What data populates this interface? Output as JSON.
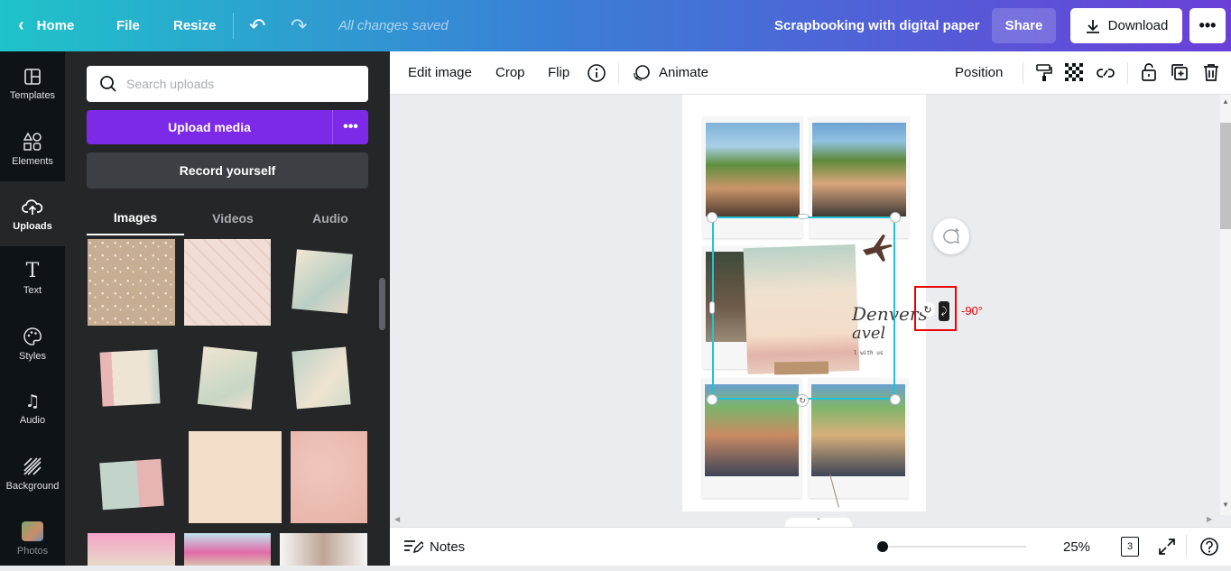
{
  "topbar": {
    "home": "Home",
    "file": "File",
    "resize": "Resize",
    "saved": "All changes saved",
    "title": "Scrapbooking with digital paper",
    "share": "Share",
    "download": "Download",
    "gradient": [
      "#1fc3c9",
      "#3a7fd6",
      "#6a3fd8"
    ]
  },
  "rail": {
    "items": [
      {
        "label": "Templates",
        "icon": "templates-icon"
      },
      {
        "label": "Elements",
        "icon": "elements-icon"
      },
      {
        "label": "Uploads",
        "icon": "upload-cloud-icon"
      },
      {
        "label": "Text",
        "icon": "text-icon"
      },
      {
        "label": "Styles",
        "icon": "palette-icon"
      },
      {
        "label": "Audio",
        "icon": "music-note-icon"
      },
      {
        "label": "Background",
        "icon": "background-icon"
      },
      {
        "label": "Photos",
        "icon": "photos-icon"
      }
    ],
    "active": "Uploads"
  },
  "panel": {
    "search_placeholder": "Search uploads",
    "upload_media": "Upload media",
    "record": "Record yourself",
    "tabs": [
      "Images",
      "Videos",
      "Audio"
    ],
    "active_tab": "Images",
    "accent": "#7d2ae8"
  },
  "toolbar": {
    "edit_image": "Edit image",
    "crop": "Crop",
    "flip": "Flip",
    "animate": "Animate",
    "position": "Position"
  },
  "canvas": {
    "text_line1": "Denvers",
    "text_line2": "avel",
    "text_line3": "l with us",
    "rotation_label": "-90°",
    "selection_color": "#22c3d6"
  },
  "bottom": {
    "notes": "Notes",
    "zoom": "25%",
    "zoom_level": 0.25,
    "pages": "3"
  }
}
